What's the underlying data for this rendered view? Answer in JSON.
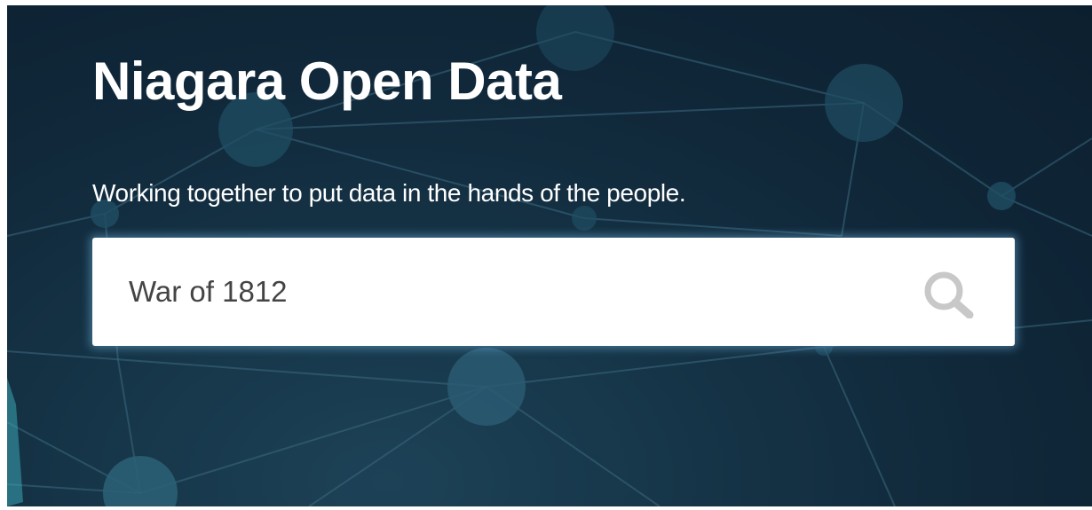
{
  "site": {
    "title": "Niagara Open Data",
    "tagline": "Working together to put data in the hands of the people."
  },
  "search": {
    "value": "War of 1812",
    "icon": "search-icon"
  },
  "colors": {
    "background": "#10283a",
    "node": "#1e4a60",
    "text": "#ffffff",
    "search_icon": "#c8c8c8"
  }
}
